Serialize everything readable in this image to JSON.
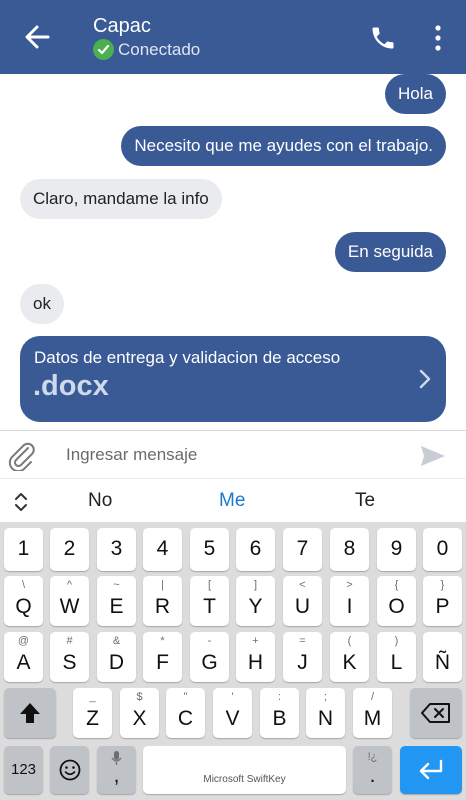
{
  "header": {
    "contact_name": "Capac",
    "status": "Conectado",
    "icons": {
      "back": "arrow-left-icon",
      "call": "phone-icon",
      "more": "more-vert-icon",
      "status": "check-circle-icon"
    }
  },
  "messages": [
    {
      "text": "Hola",
      "direction": "out"
    },
    {
      "text": "Necesito que me ayudes con el trabajo.",
      "direction": "out"
    },
    {
      "text": "Claro, mandame la info",
      "direction": "in"
    },
    {
      "text": "En seguida",
      "direction": "out"
    },
    {
      "text": "ok",
      "direction": "in"
    }
  ],
  "attachment": {
    "title": "Datos de entrega y validacion de acceso",
    "extension": ".docx"
  },
  "composer": {
    "placeholder": "Ingresar mensaje",
    "attach_icon": "paperclip-icon",
    "send_icon": "send-icon"
  },
  "suggestions": [
    "No",
    "Me",
    "Te"
  ],
  "keyboard": {
    "row_numbers": [
      "1",
      "2",
      "3",
      "4",
      "5",
      "6",
      "7",
      "8",
      "9",
      "0"
    ],
    "row_q": [
      {
        "k": "Q",
        "s": "\\"
      },
      {
        "k": "W",
        "s": "^"
      },
      {
        "k": "E",
        "s": "~"
      },
      {
        "k": "R",
        "s": "|"
      },
      {
        "k": "T",
        "s": "["
      },
      {
        "k": "Y",
        "s": "]"
      },
      {
        "k": "U",
        "s": "<"
      },
      {
        "k": "I",
        "s": ">"
      },
      {
        "k": "O",
        "s": "{"
      },
      {
        "k": "P",
        "s": "}"
      }
    ],
    "row_a": [
      {
        "k": "A",
        "s": "@"
      },
      {
        "k": "S",
        "s": "#"
      },
      {
        "k": "D",
        "s": "&"
      },
      {
        "k": "F",
        "s": "*"
      },
      {
        "k": "G",
        "s": "-"
      },
      {
        "k": "H",
        "s": "+"
      },
      {
        "k": "J",
        "s": "="
      },
      {
        "k": "K",
        "s": "("
      },
      {
        "k": "L",
        "s": ")"
      },
      {
        "k": "Ñ",
        "s": ""
      }
    ],
    "row_z": [
      {
        "k": "Z",
        "s": "_"
      },
      {
        "k": "X",
        "s": "$"
      },
      {
        "k": "C",
        "s": "\""
      },
      {
        "k": "V",
        "s": "'"
      },
      {
        "k": "B",
        "s": ":"
      },
      {
        "k": "N",
        "s": ";"
      },
      {
        "k": "M",
        "s": "/"
      }
    ],
    "bottom": {
      "numbers_label": "123",
      "comma": ",",
      "space_label": "Microsoft SwiftKey",
      "period": ".",
      "period_sub": "!¿",
      "mic_icon": "mic-icon",
      "emoji_icon": "emoji-icon",
      "enter_icon": "enter-icon",
      "shift_icon": "shift-icon",
      "backspace_icon": "backspace-icon"
    }
  },
  "colors": {
    "primary": "#3a5a96",
    "incoming_bubble": "#e9ebee",
    "online": "#4caf50",
    "suggestion_highlight": "#1a7ad4",
    "enter_key": "#2196f3"
  }
}
